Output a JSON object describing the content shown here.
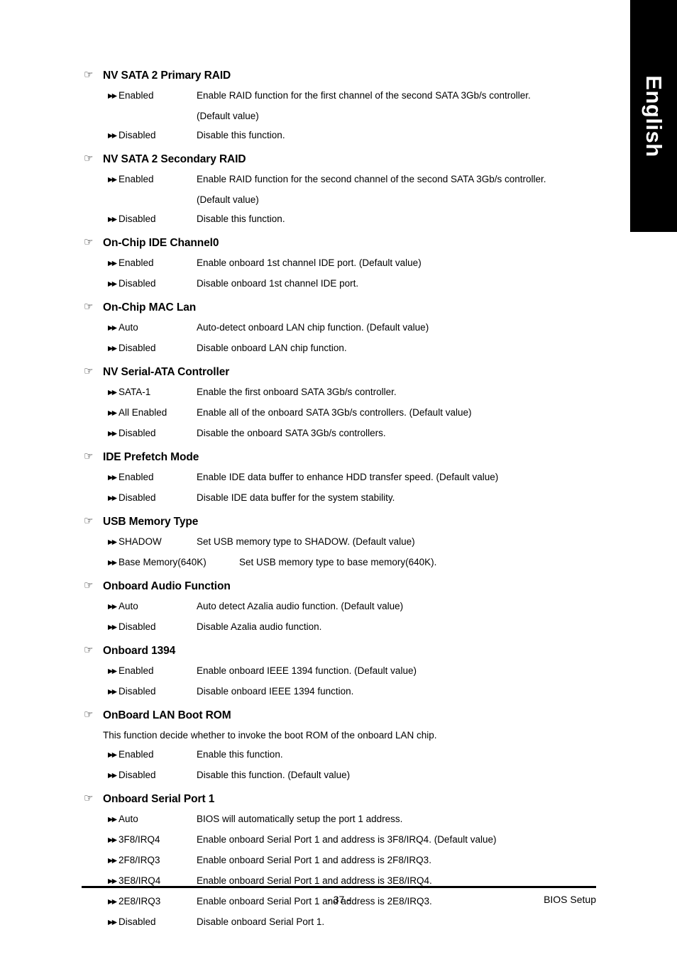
{
  "language_tab": {
    "label": "English"
  },
  "icons": {
    "hand_bullet": "☞",
    "option_arrow": "▶▶"
  },
  "sections": [
    {
      "title": "NV SATA 2 Primary RAID",
      "options": [
        {
          "label": "Enabled",
          "desc": "Enable RAID function for the first channel of the second SATA 3Gb/s controller.",
          "cont": "(Default value)"
        },
        {
          "label": "Disabled",
          "desc": "Disable this function."
        }
      ]
    },
    {
      "title": "NV SATA 2 Secondary RAID",
      "options": [
        {
          "label": "Enabled",
          "desc": "Enable RAID function for the second channel of the second SATA 3Gb/s controller.",
          "cont": "(Default value)"
        },
        {
          "label": "Disabled",
          "desc": "Disable this function."
        }
      ]
    },
    {
      "title": "On-Chip IDE Channel0",
      "options": [
        {
          "label": "Enabled",
          "desc": "Enable onboard 1st channel IDE port. (Default value)"
        },
        {
          "label": "Disabled",
          "desc": "Disable onboard 1st channel IDE port."
        }
      ]
    },
    {
      "title": "On-Chip MAC Lan",
      "options": [
        {
          "label": "Auto",
          "desc": "Auto-detect onboard LAN chip function. (Default value)"
        },
        {
          "label": "Disabled",
          "desc": "Disable onboard LAN chip function."
        }
      ]
    },
    {
      "title": "NV Serial-ATA Controller",
      "options": [
        {
          "label": "SATA-1",
          "desc": "Enable the first onboard SATA 3Gb/s controller."
        },
        {
          "label": "All Enabled",
          "desc": "Enable all of the onboard SATA 3Gb/s controllers. (Default value)"
        },
        {
          "label": "Disabled",
          "desc": "Disable the onboard SATA 3Gb/s controllers."
        }
      ]
    },
    {
      "title": "IDE Prefetch Mode",
      "options": [
        {
          "label": "Enabled",
          "desc": "Enable IDE data buffer to enhance HDD transfer speed. (Default value)"
        },
        {
          "label": "Disabled",
          "desc": "Disable IDE data buffer for the system stability."
        }
      ]
    },
    {
      "title": "USB Memory Type",
      "options": [
        {
          "label": "SHADOW",
          "desc": "Set USB memory type to SHADOW. (Default value)"
        },
        {
          "label": "Base Memory(640K)",
          "desc": "Set USB memory type to base memory(640K).",
          "wide_label": true
        }
      ]
    },
    {
      "title": "Onboard Audio Function",
      "options": [
        {
          "label": "Auto",
          "desc": "Auto detect Azalia audio function. (Default value)"
        },
        {
          "label": "Disabled",
          "desc": "Disable Azalia audio function."
        }
      ]
    },
    {
      "title": "Onboard 1394",
      "options": [
        {
          "label": "Enabled",
          "desc": "Enable onboard IEEE 1394 function. (Default value)"
        },
        {
          "label": "Disabled",
          "desc": "Disable onboard IEEE 1394 function."
        }
      ]
    },
    {
      "title": "OnBoard LAN Boot ROM",
      "note": "This function decide whether to invoke the boot ROM of the onboard LAN chip.",
      "options": [
        {
          "label": "Enabled",
          "desc": "Enable this function."
        },
        {
          "label": "Disabled",
          "desc": "Disable this function. (Default value)"
        }
      ]
    },
    {
      "title": "Onboard Serial Port 1",
      "options": [
        {
          "label": "Auto",
          "desc": "BIOS will automatically setup the port 1 address."
        },
        {
          "label": "3F8/IRQ4",
          "desc": "Enable onboard Serial Port 1 and address is 3F8/IRQ4. (Default value)"
        },
        {
          "label": "2F8/IRQ3",
          "desc": "Enable onboard Serial Port 1 and address is 2F8/IRQ3."
        },
        {
          "label": "3E8/IRQ4",
          "desc": "Enable onboard Serial Port 1 and address is 3E8/IRQ4."
        },
        {
          "label": "2E8/IRQ3",
          "desc": "Enable onboard Serial Port 1 and address is 2E8/IRQ3."
        },
        {
          "label": "Disabled",
          "desc": "Disable onboard Serial Port 1."
        }
      ]
    }
  ],
  "footer": {
    "page_number": "- 37 -",
    "right_label": "BIOS Setup"
  }
}
